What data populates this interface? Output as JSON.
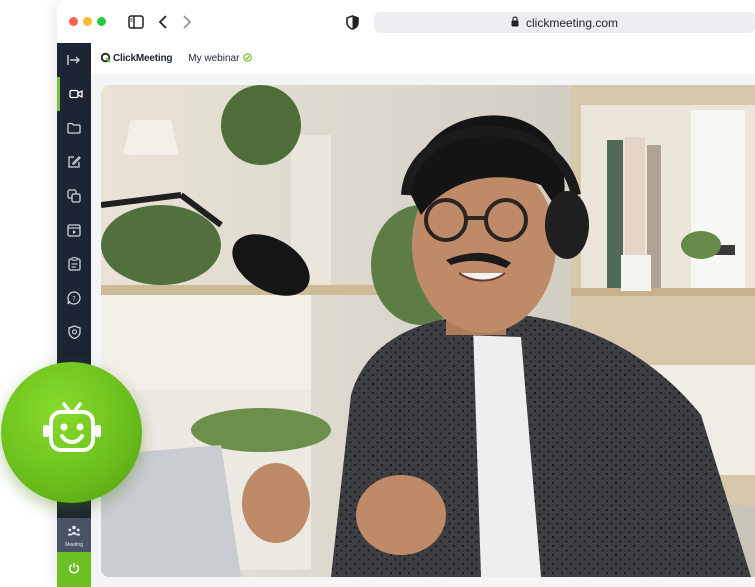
{
  "browser": {
    "url": "clickmeeting.com",
    "icons": [
      "sidebar-toggle-icon",
      "back-arrow-icon",
      "forward-arrow-icon",
      "shield-icon",
      "lock-icon"
    ]
  },
  "app": {
    "logo_text": "ClickMeeting",
    "webinar_title": "My webinar",
    "webinar_status_icon": "check-circle-icon",
    "accent_color": "#6cc024",
    "sidebar_color": "#1d2433"
  },
  "sidebar": {
    "items": [
      {
        "icon": "expand-icon"
      },
      {
        "icon": "camera-icon",
        "active": true
      },
      {
        "icon": "folder-icon"
      },
      {
        "icon": "edit-icon"
      },
      {
        "icon": "copy-icon"
      },
      {
        "icon": "video-player-icon"
      },
      {
        "icon": "clipboard-icon"
      },
      {
        "icon": "question-bubble-icon"
      },
      {
        "icon": "badge-icon"
      }
    ],
    "meeting_label": "Meeting",
    "power_icon": "power-icon"
  },
  "ai_badge": {
    "icon": "robot-icon"
  }
}
